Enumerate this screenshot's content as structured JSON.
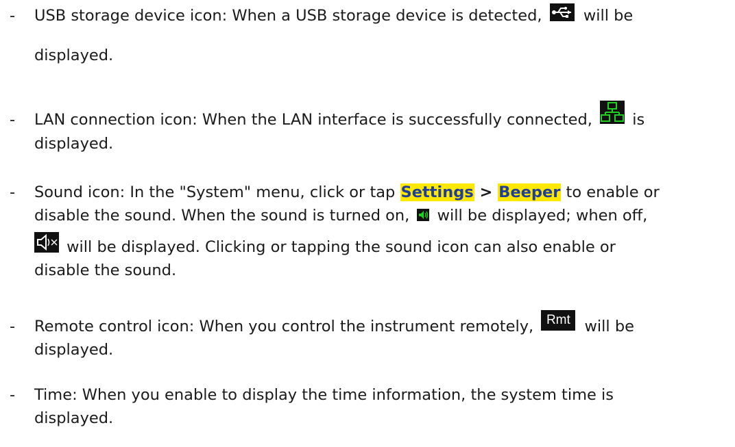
{
  "bullet": "-",
  "items": [
    {
      "id": "usb",
      "before": "USB storage device icon: When a USB storage device is detected, ",
      "after": " will be",
      "line2": "displayed.",
      "icon": "usb-icon"
    },
    {
      "id": "lan",
      "before": "LAN connection icon: When the LAN interface is successfully connected, ",
      "after": " is",
      "line2": "displayed.",
      "icon": "lan-icon"
    },
    {
      "id": "sound",
      "p1": "Sound icon: In the \"System\" menu, click or tap ",
      "hl1": "Settings",
      "sep": " > ",
      "hl2": "Beeper",
      "p2": " to enable or",
      "p3": "disable the sound. When the sound is turned on, ",
      "p4": " will be displayed; when off,",
      "p5": " will be displayed. Clicking or tapping the sound icon can also enable or",
      "p6": "disable the sound.",
      "icon_on": "sound-on-icon",
      "icon_off": "sound-off-icon",
      "colors": {
        "highlight": "#ffe800",
        "highlight_text": "#1f3f9a"
      }
    },
    {
      "id": "remote",
      "before": "Remote control icon: When you control the instrument remotely, ",
      "icon_label": "Rmt",
      "after": " will be",
      "line2": "displayed.",
      "icon": "rmt-icon"
    },
    {
      "id": "time",
      "line1": "Time: When you enable to display the time information, the system time is",
      "line2": "displayed."
    }
  ]
}
